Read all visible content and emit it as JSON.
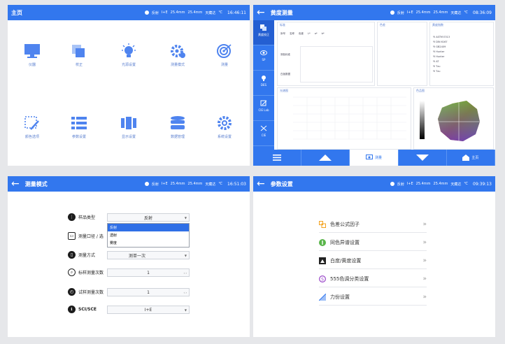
{
  "status": {
    "mode": "反射",
    "sci": "I+E",
    "aperture1": "25.4mm",
    "aperture2": "25.4mm",
    "light": "天藏达",
    "temp": "℃"
  },
  "home": {
    "title": "主页",
    "time": "16:46:11",
    "tiles": [
      {
        "label": "仪器",
        "icon": "monitor-icon"
      },
      {
        "label": "校正",
        "icon": "calibrate-icon"
      },
      {
        "label": "光源设置",
        "icon": "bulb-icon"
      },
      {
        "label": "测量模式",
        "icon": "gear-icon"
      },
      {
        "label": "测量",
        "icon": "target-icon"
      },
      {
        "label": "颜色选项",
        "icon": "pick-color-icon"
      },
      {
        "label": "参数设置",
        "icon": "list-icon"
      },
      {
        "label": "显示设置",
        "icon": "columns-icon"
      },
      {
        "label": "数据管理",
        "icon": "database-icon"
      },
      {
        "label": "系统设置",
        "icon": "system-gear-icon"
      }
    ]
  },
  "measure": {
    "title": "黄度测量",
    "time": "08:36:09",
    "side": [
      "黄度校正",
      "SP",
      "DES",
      "CIE Lab",
      "CIE"
    ],
    "panel_titles": [
      "标准",
      "色差",
      "黄度指数",
      "光谱图",
      "色品图"
    ],
    "table_headers": [
      "序号",
      "名称",
      "色差",
      "L*",
      "a*",
      "b*"
    ],
    "row_labels": [
      "测色标准",
      "白板数据"
    ],
    "yi_list": [
      "YI ASTM E313",
      "YI DIN 6167",
      "YI GB2409",
      "YI Hunter",
      "YI Hunter",
      "YI AT",
      "YI Tzu",
      "YI Tzu"
    ],
    "bottom_measure": "测量",
    "bottom_home": "主页"
  },
  "mode": {
    "title": "测量模式",
    "time": "16:51:03",
    "rows": [
      {
        "label": "样品类型",
        "value": "反射"
      },
      {
        "label": "测量口径 / 选",
        "value": ""
      },
      {
        "label": "测量方式",
        "value": "测单一次"
      },
      {
        "label": "标样测量次数",
        "value": "1"
      },
      {
        "label": "试样测量次数",
        "value": "1"
      },
      {
        "label": "SCI/SCE",
        "value": "I+E"
      }
    ],
    "dropdown_options": [
      "反射",
      "透射",
      "雾度"
    ]
  },
  "params": {
    "title": "参数设置",
    "time": "09:39:13",
    "items": [
      {
        "label": "色差公式因子",
        "color": "#f3a11c"
      },
      {
        "label": "同色异谱设置",
        "color": "#59b54a"
      },
      {
        "label": "白度/黄度设置",
        "color": "#222222"
      },
      {
        "label": "555色调分类设置",
        "color": "#9a48c9"
      },
      {
        "label": "力份设置",
        "color": "#3277ee"
      }
    ]
  }
}
